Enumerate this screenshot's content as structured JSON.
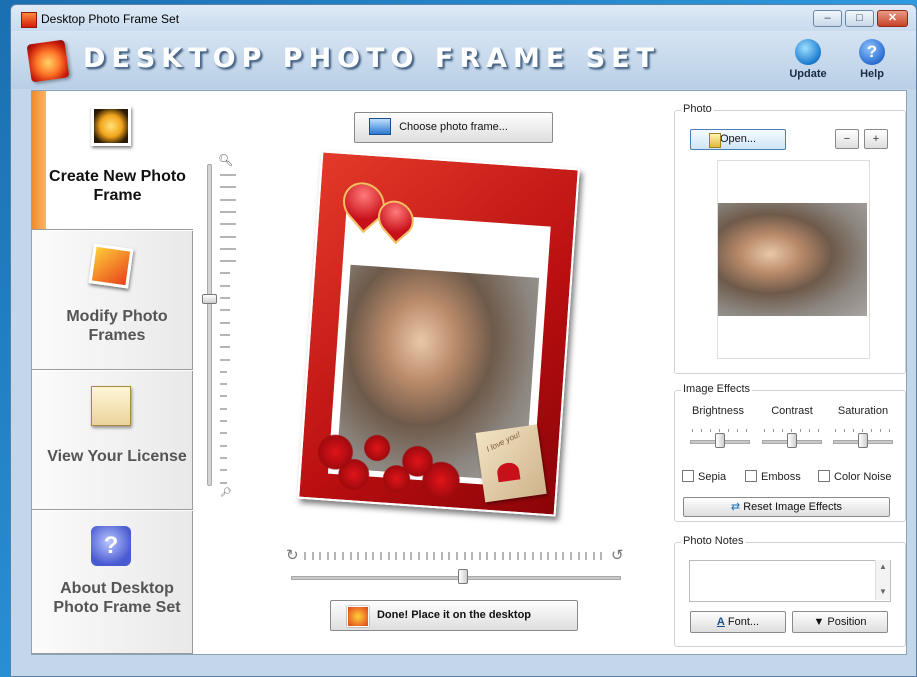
{
  "window": {
    "title": "Desktop Photo Frame Set",
    "min": "–",
    "max": "□",
    "close": "✕"
  },
  "header": {
    "app_title": "DESKTOP PHOTO FRAME SET",
    "update_label": "Update",
    "help_label": "Help",
    "help_glyph": "?"
  },
  "nav": {
    "items": [
      {
        "label": "Create New Photo Frame",
        "icon": "rose-photo-icon",
        "active": true
      },
      {
        "label": "Modify Photo Frames",
        "icon": "photos-icon",
        "active": false
      },
      {
        "label": "View Your License",
        "icon": "certificate-icon",
        "active": false
      },
      {
        "label": "About Desktop Photo Frame Set",
        "icon": "help-icon",
        "active": false,
        "glyph": "?"
      }
    ]
  },
  "center": {
    "choose_label": "Choose photo frame...",
    "done_label": "Done! Place it on the desktop",
    "zoom_level": 0.58,
    "rotation_level": 0.52,
    "envelope_text": "I love you!"
  },
  "photo_panel": {
    "label": "Photo",
    "open_label": "Open...",
    "zoom_out": "−",
    "zoom_in": "+"
  },
  "effects": {
    "label": "Image Effects",
    "sliders": [
      {
        "label": "Brightness",
        "value": 0.5
      },
      {
        "label": "Contrast",
        "value": 0.5
      },
      {
        "label": "Saturation",
        "value": 0.5
      }
    ],
    "checkboxes": [
      {
        "label": "Sepia",
        "checked": false
      },
      {
        "label": "Emboss",
        "checked": false
      },
      {
        "label": "Color Noise",
        "checked": false
      }
    ],
    "reset_label": "Reset Image Effects"
  },
  "notes": {
    "label": "Photo Notes",
    "value": "",
    "font_label": "Font...",
    "position_label": "Position"
  },
  "colors": {
    "accent": "#f08a2a",
    "frame_red": "#c8101a",
    "title_blue": "#1a4d8a"
  }
}
